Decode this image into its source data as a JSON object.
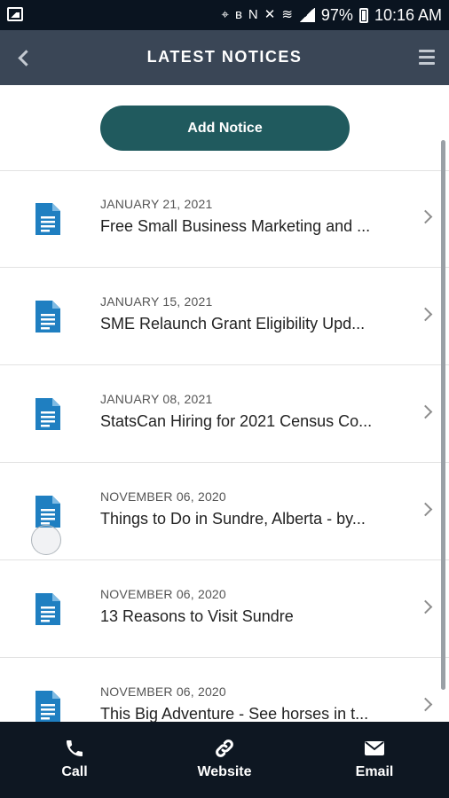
{
  "status_bar": {
    "battery": "97%",
    "time": "10:16 AM"
  },
  "header": {
    "title": "LATEST NOTICES"
  },
  "add_notice_label": "Add Notice",
  "notices": [
    {
      "date": "JANUARY 21, 2021",
      "title": "Free Small Business Marketing and ..."
    },
    {
      "date": "JANUARY 15, 2021",
      "title": "SME Relaunch Grant Eligibility Upd..."
    },
    {
      "date": "JANUARY 08, 2021",
      "title": "StatsCan Hiring for 2021 Census Co..."
    },
    {
      "date": "NOVEMBER 06, 2020",
      "title": "Things to Do in Sundre, Alberta - by..."
    },
    {
      "date": "NOVEMBER 06, 2020",
      "title": "13 Reasons to Visit Sundre"
    },
    {
      "date": "NOVEMBER 06, 2020",
      "title": "This Big Adventure - See horses in t..."
    }
  ],
  "bottom_nav": [
    {
      "label": "Call",
      "icon": "phone-icon"
    },
    {
      "label": "Website",
      "icon": "link-icon"
    },
    {
      "label": "Email",
      "icon": "envelope-icon"
    }
  ],
  "colors": {
    "header": "#3a4656",
    "accent": "#205a5e",
    "doc_icon": "#1f7fc1",
    "nav": "#0e1722"
  }
}
